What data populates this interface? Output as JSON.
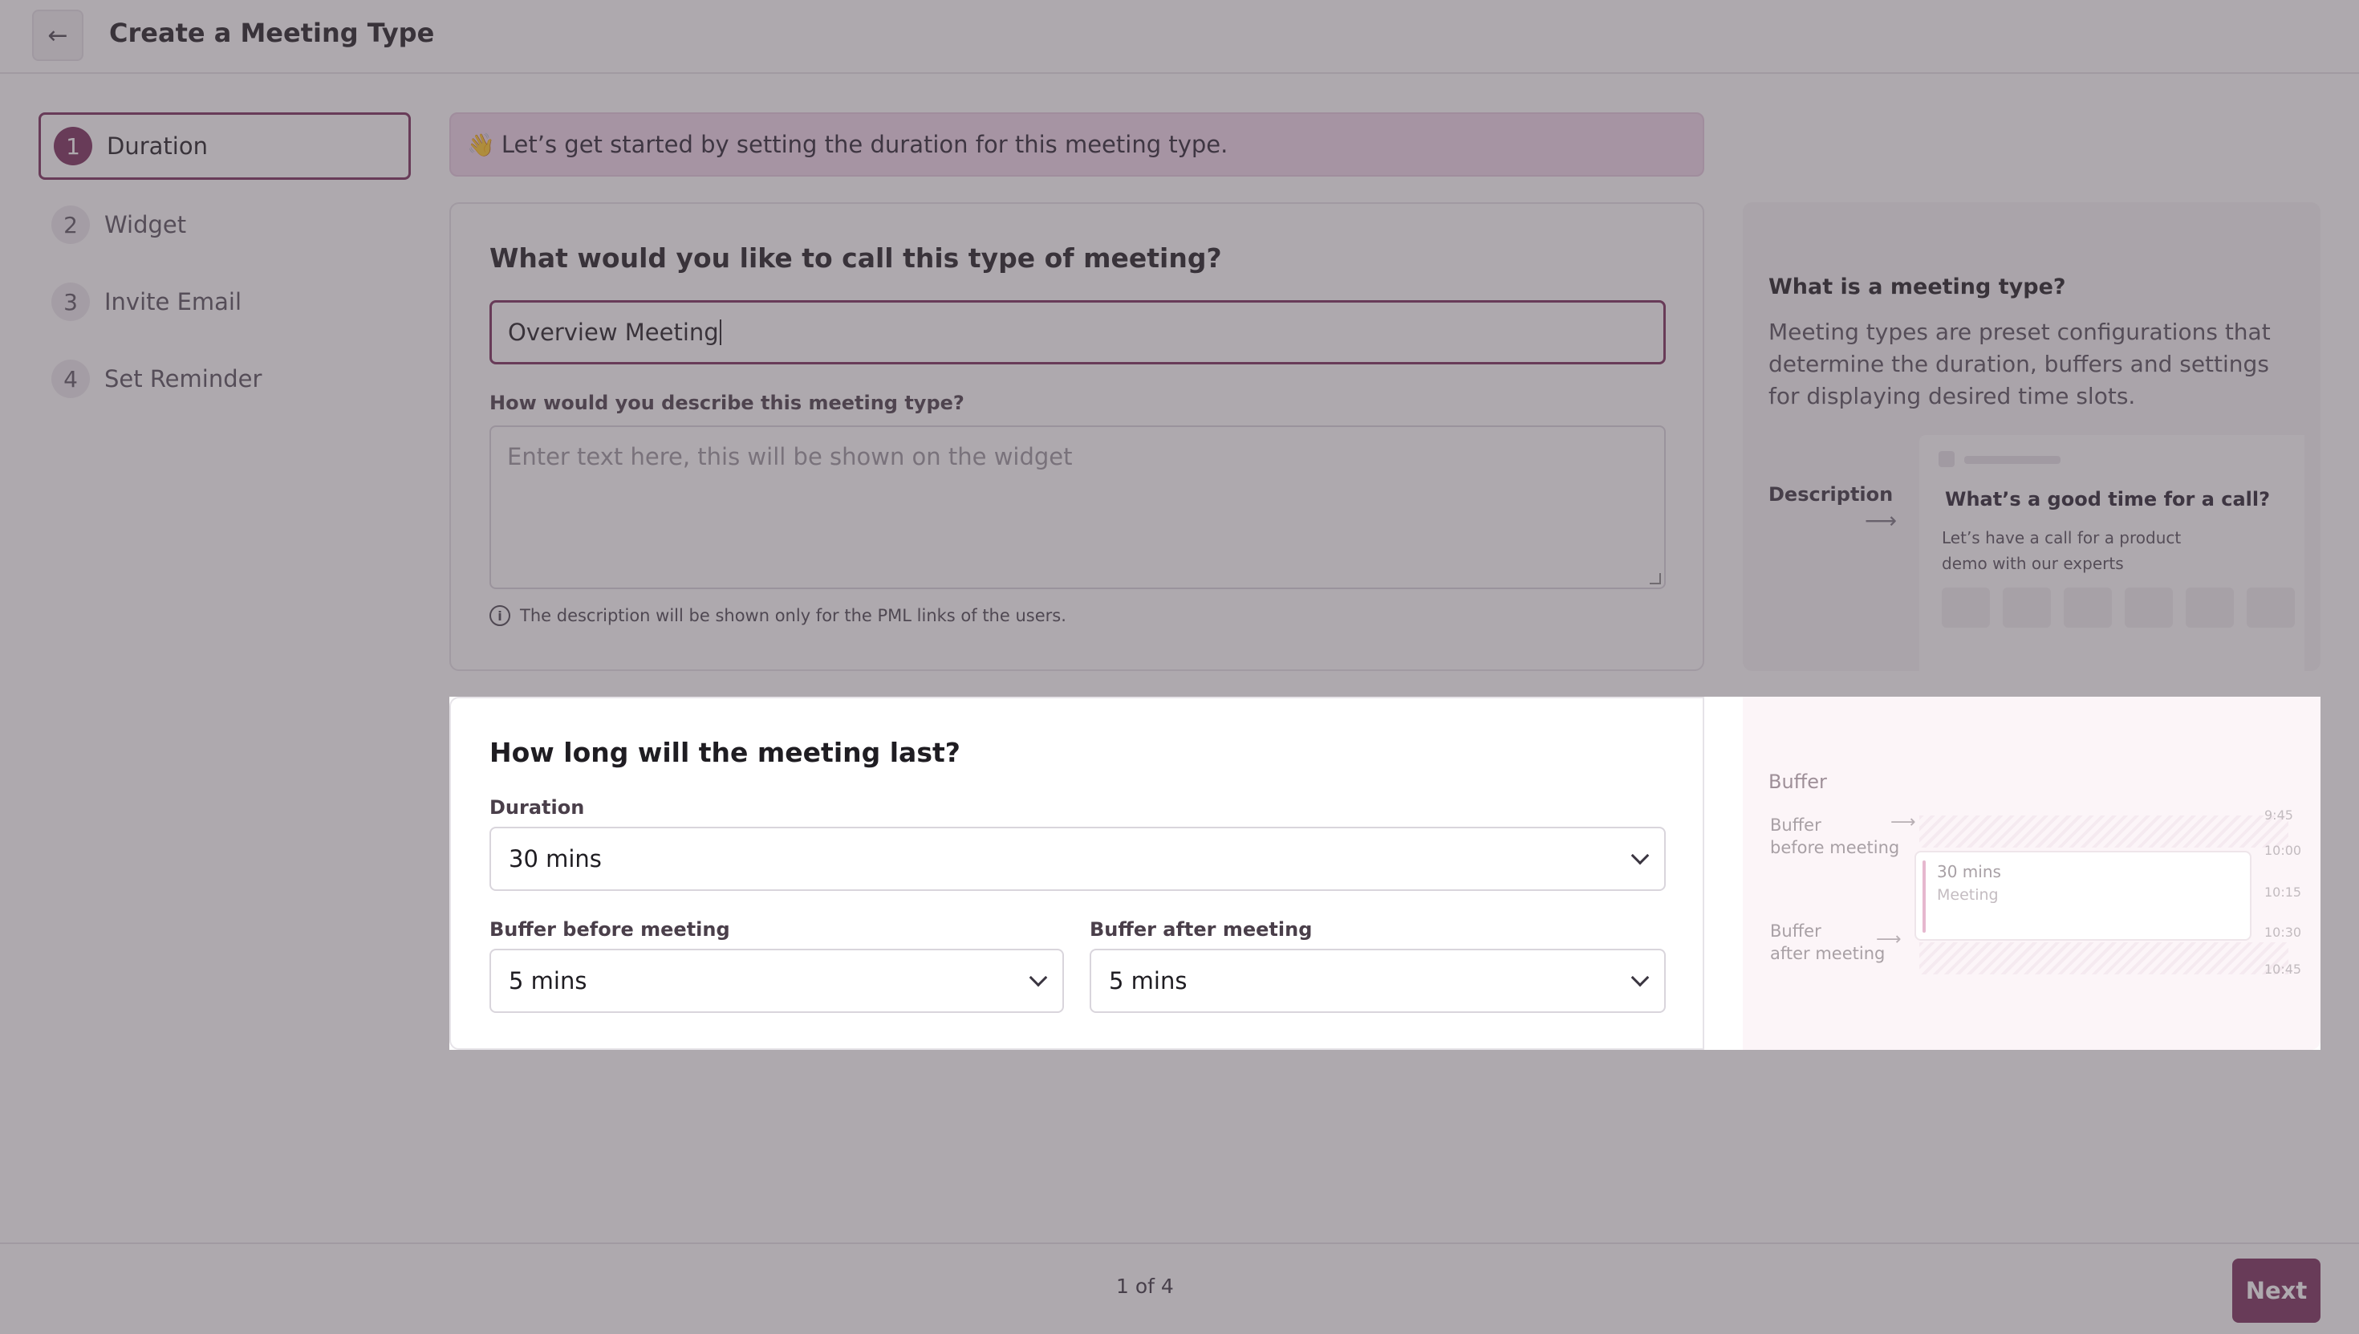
{
  "header": {
    "back_icon": "arrow-left-icon",
    "title": "Create a Meeting Type"
  },
  "steps": [
    {
      "num": "1",
      "label": "Duration",
      "active": true
    },
    {
      "num": "2",
      "label": "Widget",
      "active": false
    },
    {
      "num": "3",
      "label": "Invite Email",
      "active": false
    },
    {
      "num": "4",
      "label": "Set Reminder",
      "active": false
    }
  ],
  "banner": {
    "icon": "👋",
    "text": "Let’s get started by setting the duration for this meeting type."
  },
  "name_section": {
    "question": "What would you like to call this type of meeting?",
    "name_value": "Overview Meeting",
    "description_label": "How would you describe this meeting type?",
    "description_placeholder": "Enter text here, this will be shown on the widget",
    "hint_icon": "info-icon",
    "hint": "The description will be shown only for the PML links of the users."
  },
  "info_panel": {
    "title": "What is a meeting type?",
    "text": "Meeting types are preset configurations that determine the duration, buffers and settings for displaying desired time slots.",
    "description_label": "Description",
    "preview_title": "What’s a good time for a call?",
    "preview_text": "Let’s have a call for a product demo with our experts"
  },
  "duration_section": {
    "question": "How long will the meeting last?",
    "duration_label": "Duration",
    "duration_value": "30 mins",
    "buffer_before_label": "Buffer before meeting",
    "buffer_before_value": "5 mins",
    "buffer_after_label": "Buffer after meeting",
    "buffer_after_value": "5 mins"
  },
  "buffer_panel": {
    "title": "Buffer",
    "before_line1": "Buffer",
    "before_line2": "before meeting",
    "after_line1": "Buffer",
    "after_line2": "after meeting",
    "times": [
      "9:45",
      "10:00",
      "10:15",
      "10:30",
      "10:45"
    ],
    "meeting_duration": "30 mins",
    "meeting_label": "Meeting"
  },
  "footer": {
    "page_count": "1 of 4",
    "next_label": "Next"
  },
  "colors": {
    "accent": "#7a2d5a",
    "banner_bg": "#f0d6ea",
    "overlay": "#564c56"
  }
}
